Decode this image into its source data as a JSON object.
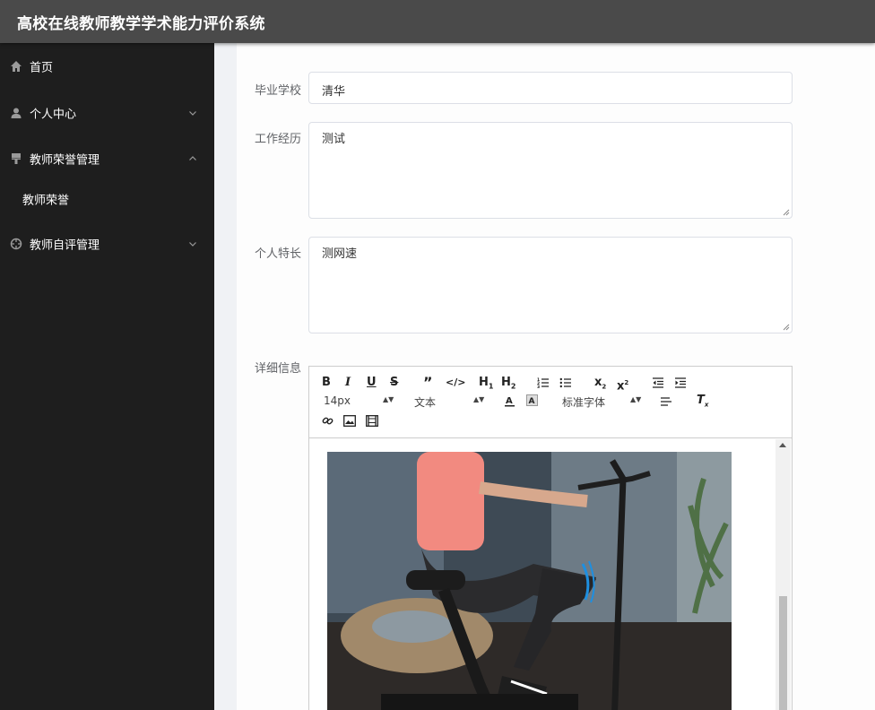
{
  "app": {
    "title": "高校在线教师教学学术能力评价系统"
  },
  "sidebar": {
    "items": [
      {
        "label": "首页",
        "icon": "home-icon"
      },
      {
        "label": "个人中心",
        "icon": "user-icon",
        "expanded": false
      },
      {
        "label": "教师荣誉管理",
        "icon": "brush-icon",
        "expanded": true,
        "children": [
          {
            "label": "教师荣誉"
          }
        ]
      },
      {
        "label": "教师自评管理",
        "icon": "compass-icon",
        "expanded": false
      }
    ]
  },
  "form": {
    "school": {
      "label": "毕业学校",
      "value": "清华"
    },
    "work": {
      "label": "工作经历",
      "value": "测试"
    },
    "specialty": {
      "label": "个人特长",
      "value": "测网速"
    },
    "detail": {
      "label": "详细信息"
    }
  },
  "editor": {
    "font_size": "14px",
    "paragraph": "文本",
    "font_family": "标准字体",
    "buttons": [
      "bold-icon",
      "italic-icon",
      "underline-icon",
      "strike-icon",
      "quote-icon",
      "code-icon",
      "h1-icon",
      "h2-icon",
      "ordered-list-icon",
      "bullet-list-icon",
      "subscript-icon",
      "superscript-icon",
      "outdent-icon",
      "indent-icon",
      "font-color-icon",
      "background-color-icon",
      "align-icon",
      "clear-format-icon",
      "link-icon",
      "image-icon",
      "video-icon"
    ],
    "image": "photo of woman exercising on stationary bike"
  },
  "colors": {
    "topbar": "#4a4a4a",
    "sidebar": "#1e1e1e",
    "content_bg": "#f0f2f5"
  }
}
